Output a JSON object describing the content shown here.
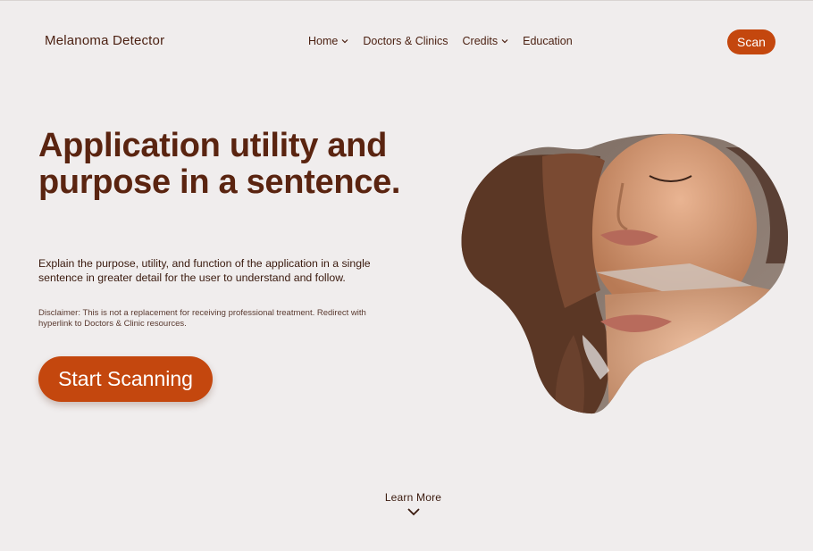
{
  "header": {
    "brand": "Melanoma Detector",
    "nav": [
      {
        "label": "Home",
        "has_dropdown": true,
        "icon": "chevron-down-icon"
      },
      {
        "label": "Doctors & Clinics",
        "has_dropdown": false
      },
      {
        "label": "Credits",
        "has_dropdown": true,
        "icon": "chevron-down-icon"
      },
      {
        "label": "Education",
        "has_dropdown": false
      }
    ],
    "scan_label": "Scan"
  },
  "hero": {
    "title": "Application utility and purpose in a sentence.",
    "description": "Explain the purpose, utility, and function of the application in a single sentence in greater detail for the user to understand and follow.",
    "disclaimer": "Disclaimer: This is not a replacement for receiving professional treatment. Redirect with hyperlink to Doctors & Clinic resources.",
    "cta_label": "Start Scanning"
  },
  "footer": {
    "learn_more_label": "Learn More",
    "learn_more_icon": "chevron-down-icon"
  },
  "colors": {
    "background": "#f0eded",
    "accent": "#c4470e",
    "text_dark": "#4a1f10"
  }
}
